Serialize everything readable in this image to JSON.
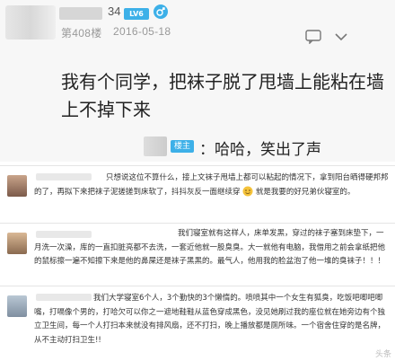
{
  "post": {
    "level": "34",
    "level_badge": "LV6",
    "gender_icon": "male-icon",
    "floor": "第408楼",
    "date": "2016-05-18",
    "body": "我有个同学，把袜子脱了甩墙上能粘在墙上不掉下来",
    "quote_badge": "楼主",
    "quote_text": "：哈哈，笑出了声"
  },
  "comments": [
    {
      "text": "只想说这位不算什么，接上文袜子甩墙上都可以粘起的情况下，拿到阳台晒得硬邦邦的了，再拟下来把袜子泥搓搓到床软了，抖抖灰反一面继续穿",
      "text_after_icon": "就是我要的好兄弟伙寝室的。"
    },
    {
      "text": "我们寝室就有这样人，床单发黑，穿过的袜子塞到床垫下，一月洗一次澡，库的一直扣脏亮都不去洗，一套近他就一股臭臭。大一就他有电脑，我借用之前会拿纸把他的鼠标擦一遍不知擦下来是他的鼻屎还是袜子黑黑的。最气人，他用我的脸盆泡了他一堆的臭袜子！！！"
    },
    {
      "text": "我们大学寝室6个人，3个勤快的3个懒惰的。喷喷其中一个女生有狐臭，吃饭吧唧吧唧嘴，打嗝像个男的，打哈欠可以你之一遮地鞋鞋从蓝色穿成黑色，没见她刷过我的座位就在她旁边有个独立卫生间，每一个人打扫本来就没有排风扇，还不打扫，晚上播放都是厕所味。一个宿舍住穿的是名牌，从不主动打扫卫生!!"
    }
  ],
  "watermark": "头条",
  "colors": {
    "accent": "#3db0e8",
    "page_bg": "#f7f7f7",
    "muted": "#999999"
  }
}
